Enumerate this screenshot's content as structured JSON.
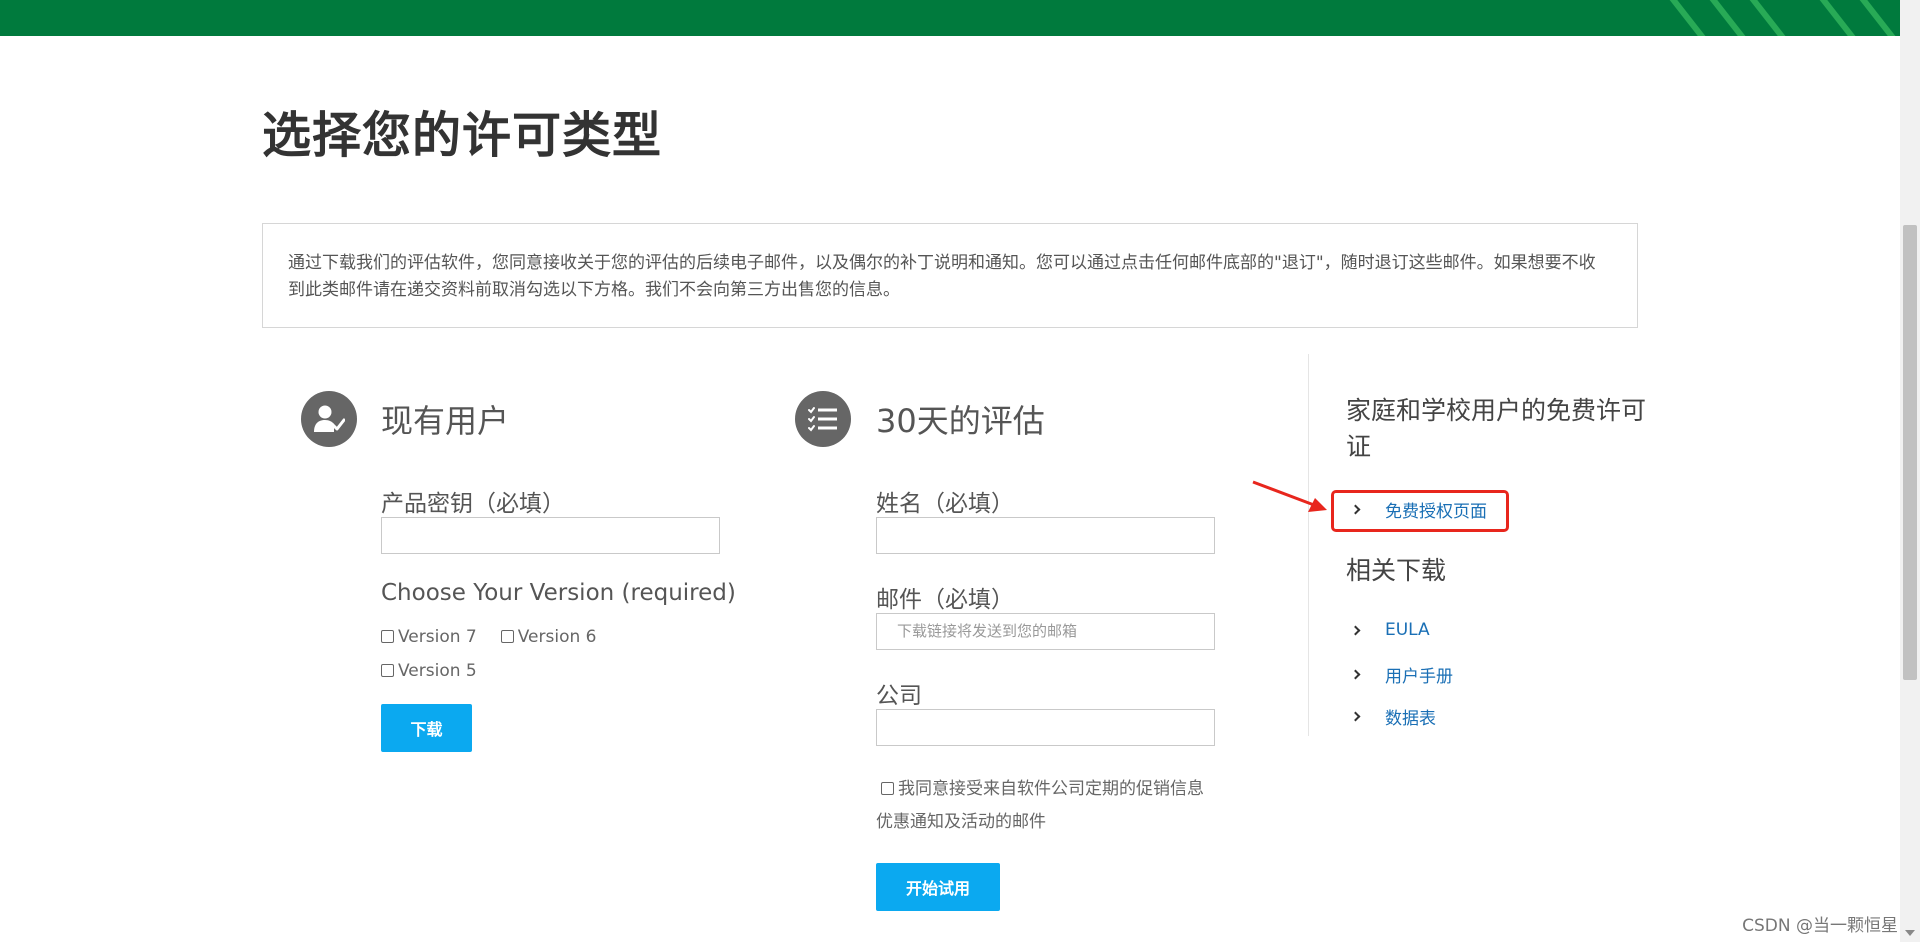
{
  "header": {
    "brand_color": "#007a3d"
  },
  "page_title": "选择您的许可类型",
  "notice_text": "通过下载我们的评估软件，您同意接收关于您的评估的后续电子邮件，以及偶尔的补丁说明和通知。您可以通过点击任何邮件底部的\"退订\"，随时退订这些邮件。如果想要不收到此类邮件请在递交资料前取消勾选以下方格。我们不会向第三方出售您的信息。",
  "existing_user": {
    "title": "现有用户",
    "icon": "user-check-icon",
    "product_key_label": "产品密钥（必填）",
    "product_key_value": "",
    "version_label": "Choose Your Version (required)",
    "versions": [
      "Version 7",
      "Version 6",
      "Version 5"
    ],
    "download_button": "下载"
  },
  "evaluation": {
    "title": "30天的评估",
    "icon": "checklist-icon",
    "name_label": "姓名（必填）",
    "name_value": "",
    "email_label": "邮件（必填）",
    "email_placeholder": "下载链接将发送到您的邮箱",
    "company_label": "公司",
    "company_value": "",
    "consent_text": "我同意接受来自软件公司定期的促销信息优惠通知及活动的邮件",
    "start_button": "开始试用",
    "button_color": "#0ba9f0"
  },
  "sidebar": {
    "free_license_heading": "家庭和学校用户的免费许可证",
    "free_license_link": "免费授权页面",
    "downloads_heading": "相关下载",
    "download_links": [
      "EULA",
      "用户手册",
      "数据表"
    ],
    "link_color": "#1a6fb5"
  },
  "annotation": {
    "highlight_color": "#e8261d"
  },
  "watermark": "CSDN @当一颗恒星"
}
